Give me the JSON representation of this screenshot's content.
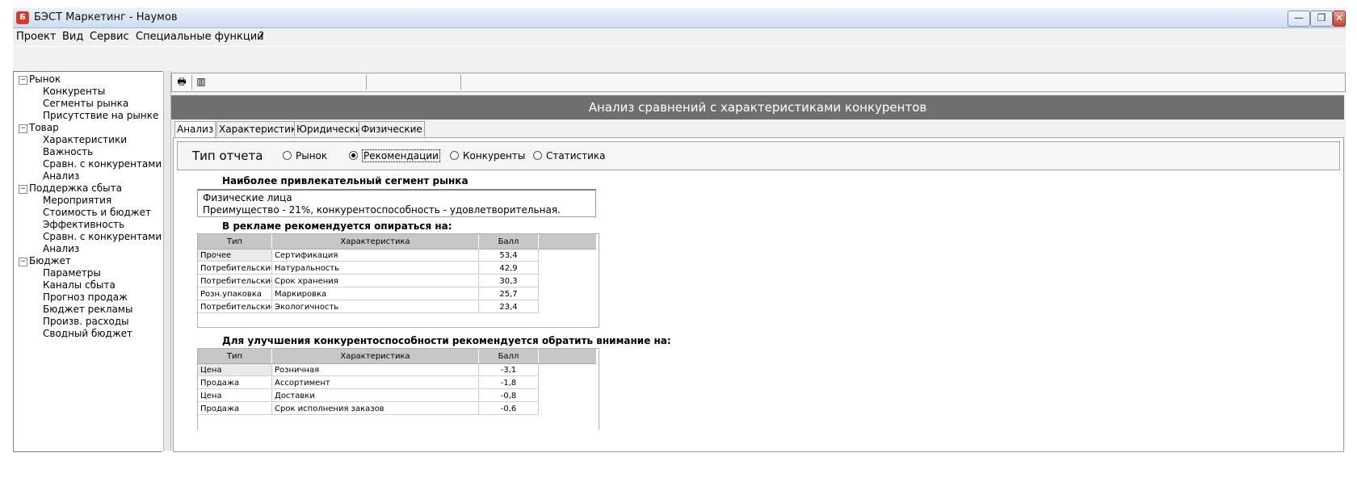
{
  "window": {
    "title": "БЭСТ Маркетинг - Наумов",
    "icon": "app-icon",
    "buttons": {
      "minimize": "—",
      "maximize": "❐",
      "close": "✕"
    }
  },
  "menu": [
    "Проект",
    "Вид",
    "Сервис",
    "Специальные функции",
    "?"
  ],
  "tree": [
    {
      "label": "Рынок",
      "expanded": true,
      "children": [
        "Конкуренты",
        "Сегменты рынка",
        "Присутствие на рынке"
      ]
    },
    {
      "label": "Товар",
      "expanded": true,
      "children": [
        "Характеристики",
        "Важность",
        "Сравн. с конкурентами",
        "Анализ"
      ]
    },
    {
      "label": "Поддержка сбыта",
      "expanded": true,
      "children": [
        "Мероприятия",
        "Стоимость и бюджет",
        "Эффективность",
        "Сравн. с конкурентами",
        "Анализ"
      ]
    },
    {
      "label": "Бюджет",
      "expanded": true,
      "children": [
        "Параметры",
        "Каналы сбыта",
        "Прогноз продаж",
        "Бюджет рекламы",
        "Произв. расходы",
        "Сводный бюджет"
      ]
    }
  ],
  "toolbar": {
    "icons": [
      "print-icon",
      "chart-icon"
    ]
  },
  "header": {
    "title": "Анализ сравнений с характеристиками конкурентов"
  },
  "tabs": [
    "Анализ",
    "Характеристики",
    "Юридические",
    "Физические"
  ],
  "active_tab": "Анализ",
  "report_type": {
    "label": "Тип отчета",
    "options": [
      "Рынок",
      "Рекомендации",
      "Конкуренты",
      "Статистика"
    ],
    "selected": "Рекомендации"
  },
  "segment": {
    "title": "Наиболее привлекательный сегмент рынка",
    "lines": [
      "Физические лица",
      "Преимущество - 21%,  конкурентоспособность - удовлетворительная."
    ]
  },
  "advertising": {
    "title": "В рекламе рекомендуется опираться на:",
    "columns": [
      "Тип",
      "Характеристика",
      "Балл"
    ],
    "rows": [
      [
        "Прочее",
        "Сертификация",
        "53,4"
      ],
      [
        "Потребительские",
        "Натуральность",
        "42,9"
      ],
      [
        "Потребительские",
        "Срок хранения",
        "30,3"
      ],
      [
        "Розн.упаковка",
        "Маркировка",
        "25,7"
      ],
      [
        "Потребительские",
        "Экологичность",
        "23,4"
      ]
    ]
  },
  "improvement": {
    "title": "Для улучшения конкурентоспособности рекомендуется обратить внимание на:",
    "columns": [
      "Тип",
      "Характеристика",
      "Балл"
    ],
    "rows": [
      [
        "Цена",
        "Розничная",
        "-3,1"
      ],
      [
        "Продажа",
        "Ассортимент",
        "-1,8"
      ],
      [
        "Цена",
        "Доставки",
        "-0,8"
      ],
      [
        "Продажа",
        "Срок исполнения заказов",
        "-0,6"
      ]
    ]
  }
}
